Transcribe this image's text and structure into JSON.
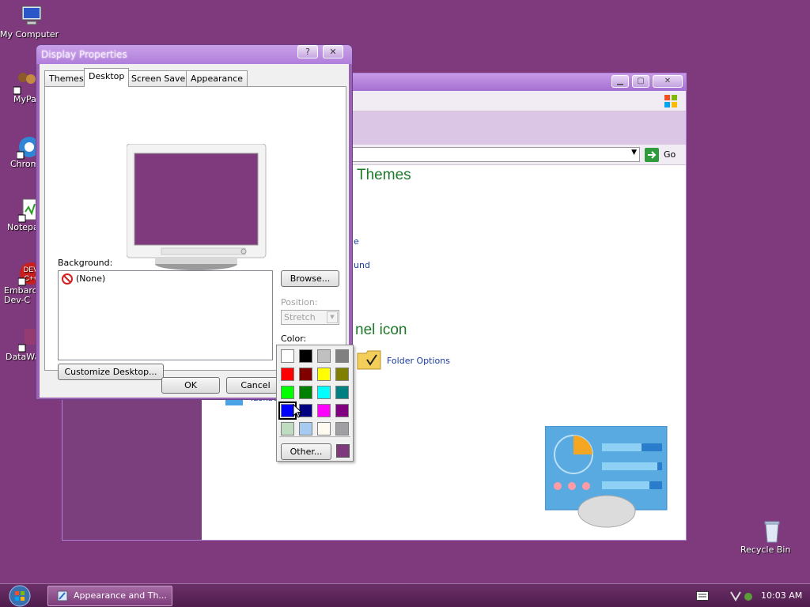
{
  "desktop": {
    "icons": [
      {
        "label": "My Computer"
      },
      {
        "label": "MyPa"
      },
      {
        "label": "Chrom"
      },
      {
        "label": "Notepa"
      },
      {
        "label": "Embarc\nDev-C"
      },
      {
        "label": "DataWa"
      }
    ],
    "recycle_bin": "Recycle Bin"
  },
  "control_panel": {
    "go_label": "Go",
    "heading_themes": "Themes",
    "heading_icon": "nel icon",
    "link_e": "e",
    "link_und": "und",
    "folder_options": "Folder Options",
    "taskbar_link": "Taskba"
  },
  "dialog": {
    "title": "Display Properties",
    "help_btn": "?",
    "close_btn": "✕",
    "tabs": [
      "Themes",
      "Desktop",
      "Screen Saver",
      "Appearance"
    ],
    "active_tab": "Desktop",
    "background_label": "Background:",
    "background_items": [
      "(None)"
    ],
    "browse": "Browse...",
    "position_label": "Position:",
    "position_value": "Stretch",
    "color_label": "Color:",
    "color_value": "#7e3a7c",
    "customize": "Customize Desktop...",
    "ok": "OK",
    "cancel": "Cancel"
  },
  "color_picker": {
    "swatches": [
      "#ffffff",
      "#000000",
      "#c0c0c0",
      "#808080",
      "#ff0000",
      "#800000",
      "#ffff00",
      "#808000",
      "#00ff00",
      "#008000",
      "#00ffff",
      "#008080",
      "#0000ff",
      "#000080",
      "#ff00ff",
      "#800080",
      "#c0dcc0",
      "#a6caf0",
      "#fffbf0",
      "#a0a0a4"
    ],
    "selected_index": 12,
    "other": "Other...",
    "custom": "#7e3a7c"
  },
  "taskbar": {
    "task": "Appearance and Th...",
    "clock": "10:03 AM"
  }
}
